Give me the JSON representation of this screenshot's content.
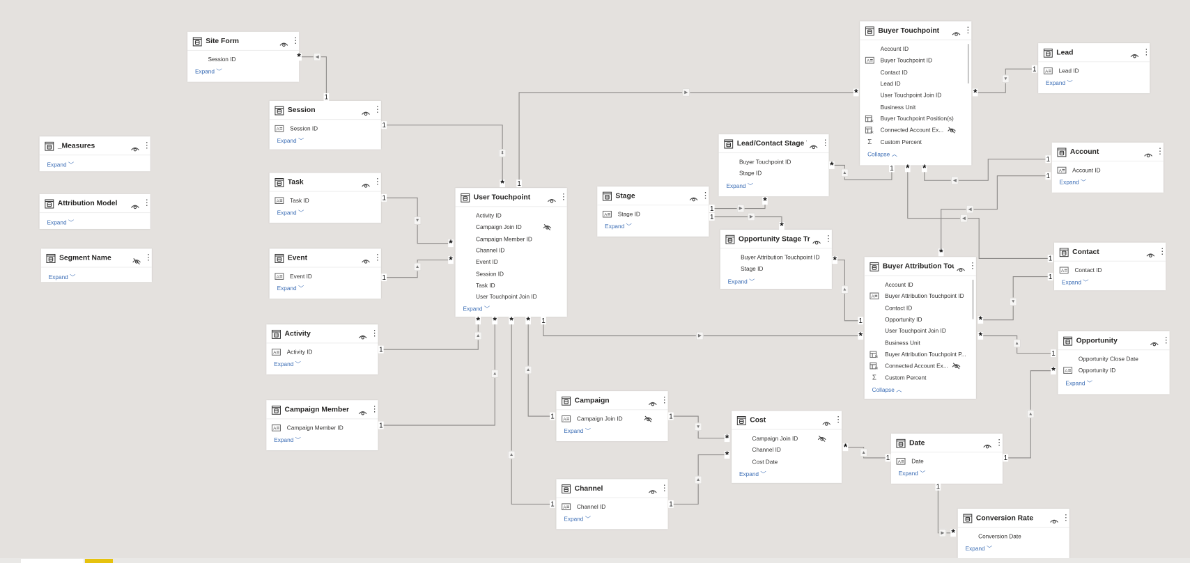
{
  "tables": [
    {
      "name": "Site Form",
      "fields": [
        {
          "name": "Session ID",
          "icon": "none"
        }
      ],
      "footer": "Expand",
      "footer_icon": "chevron-down"
    },
    {
      "name": "Session",
      "fields": [
        {
          "name": "Session ID",
          "icon": "key"
        }
      ],
      "footer": "Expand",
      "footer_icon": "chevron-down"
    },
    {
      "name": "_Measures",
      "fields": [],
      "footer": "Expand",
      "footer_icon": "chevron-down"
    },
    {
      "name": "Attribution Model",
      "fields": [],
      "footer": "Expand",
      "footer_icon": "chevron-down"
    },
    {
      "name": "Segment Name",
      "hidden": true,
      "fields": [],
      "footer": "Expand",
      "footer_icon": "chevron-down"
    },
    {
      "name": "Task",
      "fields": [
        {
          "name": "Task ID",
          "icon": "key"
        }
      ],
      "footer": "Expand",
      "footer_icon": "chevron-down"
    },
    {
      "name": "Event",
      "fields": [
        {
          "name": "Event ID",
          "icon": "key"
        }
      ],
      "footer": "Expand",
      "footer_icon": "chevron-down"
    },
    {
      "name": "User Touchpoint",
      "fields": [
        {
          "name": "Activity ID",
          "icon": "none"
        },
        {
          "name": "Campaign Join ID",
          "icon": "none",
          "hidden": true
        },
        {
          "name": "Campaign Member ID",
          "icon": "none"
        },
        {
          "name": "Channel ID",
          "icon": "none"
        },
        {
          "name": "Event ID",
          "icon": "none"
        },
        {
          "name": "Session ID",
          "icon": "none"
        },
        {
          "name": "Task ID",
          "icon": "none"
        },
        {
          "name": "User Touchpoint Join ID",
          "icon": "none"
        }
      ],
      "footer": "Expand",
      "footer_icon": "chevron-down"
    },
    {
      "name": "Activity",
      "fields": [
        {
          "name": "Activity ID",
          "icon": "key"
        }
      ],
      "footer": "Expand",
      "footer_icon": "chevron-down"
    },
    {
      "name": "Campaign Member",
      "fields": [
        {
          "name": "Campaign Member ID",
          "icon": "key"
        }
      ],
      "footer": "Expand",
      "footer_icon": "chevron-down"
    },
    {
      "name": "Stage",
      "fields": [
        {
          "name": "Stage ID",
          "icon": "key"
        }
      ],
      "footer": "Expand",
      "footer_icon": "chevron-down"
    },
    {
      "name": "Lead/Contact Stage T...",
      "fields": [
        {
          "name": "Buyer Touchpoint ID",
          "icon": "none"
        },
        {
          "name": "Stage ID",
          "icon": "none"
        }
      ],
      "footer": "Expand",
      "footer_icon": "chevron-down"
    },
    {
      "name": "Opportunity Stage Tr...",
      "fields": [
        {
          "name": "Buyer Attribution Touchpoint ID",
          "icon": "none"
        },
        {
          "name": "Stage ID",
          "icon": "none"
        }
      ],
      "footer": "Expand",
      "footer_icon": "chevron-down"
    },
    {
      "name": "Buyer Touchpoint",
      "fields": [
        {
          "name": "Account ID",
          "icon": "none"
        },
        {
          "name": "Buyer Touchpoint ID",
          "icon": "key"
        },
        {
          "name": "Contact ID",
          "icon": "none"
        },
        {
          "name": "Lead ID",
          "icon": "none"
        },
        {
          "name": "User Touchpoint Join ID",
          "icon": "none"
        },
        {
          "name": "Business Unit",
          "icon": "none"
        },
        {
          "name": "Buyer Touchpoint Position(s)",
          "icon": "calc"
        },
        {
          "name": "Connected Account Ex...",
          "icon": "calc",
          "hidden": true
        },
        {
          "name": "Custom Percent",
          "icon": "sigma"
        }
      ],
      "footer": "Collapse",
      "footer_icon": "chevron-up"
    },
    {
      "name": "Lead",
      "fields": [
        {
          "name": "Lead ID",
          "icon": "key"
        }
      ],
      "footer": "Expand",
      "footer_icon": "chevron-down"
    },
    {
      "name": "Account",
      "fields": [
        {
          "name": "Account ID",
          "icon": "key"
        }
      ],
      "footer": "Expand",
      "footer_icon": "chevron-down"
    },
    {
      "name": "Contact",
      "fields": [
        {
          "name": "Contact ID",
          "icon": "key"
        }
      ],
      "footer": "Expand",
      "footer_icon": "chevron-down"
    },
    {
      "name": "Buyer Attribution Tou...",
      "fields": [
        {
          "name": "Account ID",
          "icon": "none"
        },
        {
          "name": "Buyer Attribution Touchpoint ID",
          "icon": "key"
        },
        {
          "name": "Contact ID",
          "icon": "none"
        },
        {
          "name": "Opportunity ID",
          "icon": "none"
        },
        {
          "name": "User Touchpoint Join ID",
          "icon": "none"
        },
        {
          "name": "Business Unit",
          "icon": "none"
        },
        {
          "name": "Buyer Attribution Touchpoint P...",
          "icon": "calc"
        },
        {
          "name": "Connected Account Ex...",
          "icon": "calc",
          "hidden": true
        },
        {
          "name": "Custom Percent",
          "icon": "sigma"
        }
      ],
      "footer": "Collapse",
      "footer_icon": "chevron-up"
    },
    {
      "name": "Opportunity",
      "fields": [
        {
          "name": "Opportunity Close Date",
          "icon": "none"
        },
        {
          "name": "Opportunity ID",
          "icon": "key"
        }
      ],
      "footer": "Expand",
      "footer_icon": "chevron-down"
    },
    {
      "name": "Campaign",
      "fields": [
        {
          "name": "Campaign Join ID",
          "icon": "key",
          "hidden": true
        }
      ],
      "footer": "Expand",
      "footer_icon": "chevron-down"
    },
    {
      "name": "Channel",
      "fields": [
        {
          "name": "Channel ID",
          "icon": "key"
        }
      ],
      "footer": "Expand",
      "footer_icon": "chevron-down"
    },
    {
      "name": "Cost",
      "fields": [
        {
          "name": "Campaign Join ID",
          "icon": "none",
          "hidden": true
        },
        {
          "name": "Channel ID",
          "icon": "none"
        },
        {
          "name": "Cost Date",
          "icon": "none"
        }
      ],
      "footer": "Expand",
      "footer_icon": "chevron-down"
    },
    {
      "name": "Date",
      "fields": [
        {
          "name": "Date",
          "icon": "key"
        }
      ],
      "footer": "Expand",
      "footer_icon": "chevron-down"
    },
    {
      "name": "Conversion Rate",
      "fields": [
        {
          "name": "Conversion Date",
          "icon": "none"
        }
      ],
      "footer": "Expand",
      "footer_icon": "chevron-down"
    }
  ],
  "relationships": [
    {
      "from": "Site Form",
      "to": "Session",
      "from_card": "*",
      "to_card": "1",
      "direction": "single"
    },
    {
      "from": "User Touchpoint",
      "to": "Session",
      "from_card": "*",
      "to_card": "1",
      "direction": "both"
    },
    {
      "from": "Buyer Touchpoint",
      "to": "User Touchpoint",
      "from_card": "*",
      "to_card": "1",
      "direction": "single"
    },
    {
      "from": "User Touchpoint",
      "to": "Task",
      "from_card": "*",
      "to_card": "1",
      "direction": "single"
    },
    {
      "from": "User Touchpoint",
      "to": "Event",
      "from_card": "*",
      "to_card": "1",
      "direction": "single"
    },
    {
      "from": "User Touchpoint",
      "to": "Activity",
      "from_card": "*",
      "to_card": "1",
      "direction": "single"
    },
    {
      "from": "User Touchpoint",
      "to": "Campaign Member",
      "from_card": "*",
      "to_card": "1",
      "direction": "single"
    },
    {
      "from": "User Touchpoint",
      "to": "Channel",
      "from_card": "*",
      "to_card": "1",
      "direction": "single"
    },
    {
      "from": "User Touchpoint",
      "to": "Campaign",
      "from_card": "*",
      "to_card": "1",
      "direction": "single"
    },
    {
      "from": "Buyer Attribution Tou...",
      "to": "User Touchpoint",
      "from_card": "*",
      "to_card": "1",
      "direction": "single"
    },
    {
      "from": "Lead/Contact Stage T...",
      "to": "Stage",
      "from_card": "*",
      "to_card": "1",
      "direction": "single"
    },
    {
      "from": "Opportunity Stage Tr...",
      "to": "Stage",
      "from_card": "*",
      "to_card": "1",
      "direction": "single"
    },
    {
      "from": "Lead/Contact Stage T...",
      "to": "Buyer Touchpoint",
      "from_card": "*",
      "to_card": "1",
      "direction": "single"
    },
    {
      "from": "Buyer Touchpoint",
      "to": "Contact",
      "from_card": "*",
      "to_card": "1",
      "direction": "single"
    },
    {
      "from": "Buyer Touchpoint",
      "to": "Account",
      "from_card": "*",
      "to_card": "1",
      "direction": "single"
    },
    {
      "from": "Buyer Attribution Tou...",
      "to": "Account",
      "from_card": "*",
      "to_card": "1",
      "direction": "single"
    },
    {
      "from": "Buyer Touchpoint",
      "to": "Lead",
      "from_card": "*",
      "to_card": "1",
      "direction": "single"
    },
    {
      "from": "Opportunity Stage Tr...",
      "to": "Buyer Attribution Tou...",
      "from_card": "*",
      "to_card": "1",
      "direction": "single"
    },
    {
      "from": "Buyer Attribution Tou...",
      "to": "Contact",
      "from_card": "*",
      "to_card": "1",
      "direction": "single"
    },
    {
      "from": "Buyer Attribution Tou...",
      "to": "Opportunity",
      "from_card": "*",
      "to_card": "1",
      "direction": "single"
    },
    {
      "from": "Opportunity",
      "to": "Date",
      "from_card": "*",
      "to_card": "1",
      "direction": "single"
    },
    {
      "from": "Cost",
      "to": "Campaign",
      "from_card": "*",
      "to_card": "1",
      "direction": "single"
    },
    {
      "from": "Cost",
      "to": "Channel",
      "from_card": "*",
      "to_card": "1",
      "direction": "single"
    },
    {
      "from": "Cost",
      "to": "Date",
      "from_card": "*",
      "to_card": "1",
      "direction": "single"
    },
    {
      "from": "Conversion Rate",
      "to": "Date",
      "from_card": "*",
      "to_card": "1",
      "direction": "single"
    }
  ],
  "page_tabs": [
    {
      "label": "",
      "active": true
    },
    {
      "label": "",
      "active": false
    }
  ],
  "colors": {
    "canvas": "#e4e1de",
    "link": "#3b6db5",
    "line": "#8a8886",
    "accent_tab": "#e6c20e"
  }
}
